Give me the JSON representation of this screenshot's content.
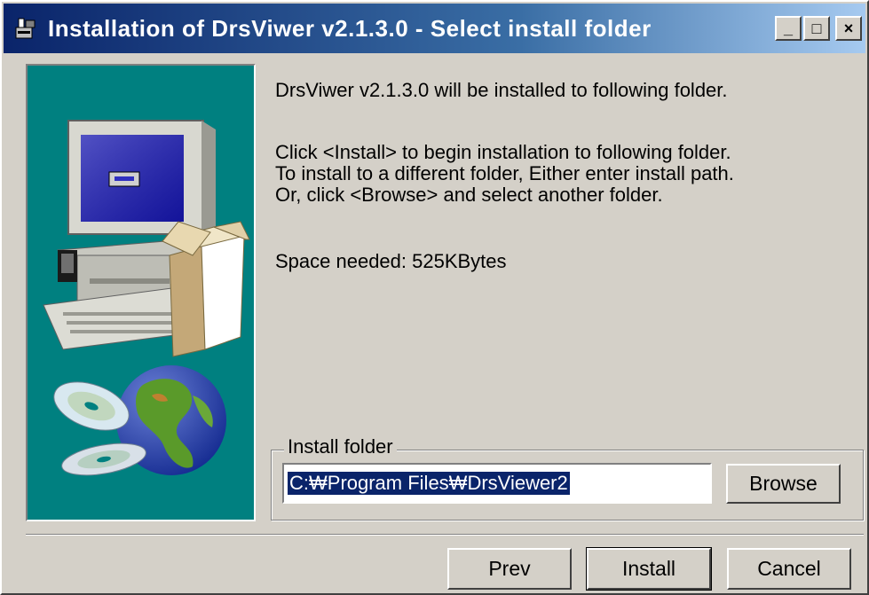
{
  "window": {
    "title": "Installation of DrsViwer v2.1.3.0 - Select install folder",
    "controls": {
      "minimize": "_",
      "maximize": "□",
      "close": "×"
    }
  },
  "main": {
    "line1": "DrsViwer v2.1.3.0 will be installed to following folder.",
    "instructions": [
      "Click <Install> to begin installation to following folder.",
      "To install to a different folder, Either enter install path.",
      "Or, click <Browse> and select another folder."
    ],
    "space_needed": "Space needed: 525KBytes"
  },
  "install_folder": {
    "label": "Install folder",
    "path": "C:₩Program Files₩DrsViewer2",
    "browse_label": "Browse"
  },
  "footer": {
    "prev_label": "Prev",
    "install_label": "Install",
    "cancel_label": "Cancel"
  },
  "colors": {
    "title_active": "#0a246a",
    "title_gradient_end": "#a6caf0",
    "panel_bg": "#008080",
    "dialog_bg": "#d4d0c8"
  },
  "icons": {
    "app": "installer-icon",
    "side_image": "computer-box-cd-globe-illustration"
  }
}
